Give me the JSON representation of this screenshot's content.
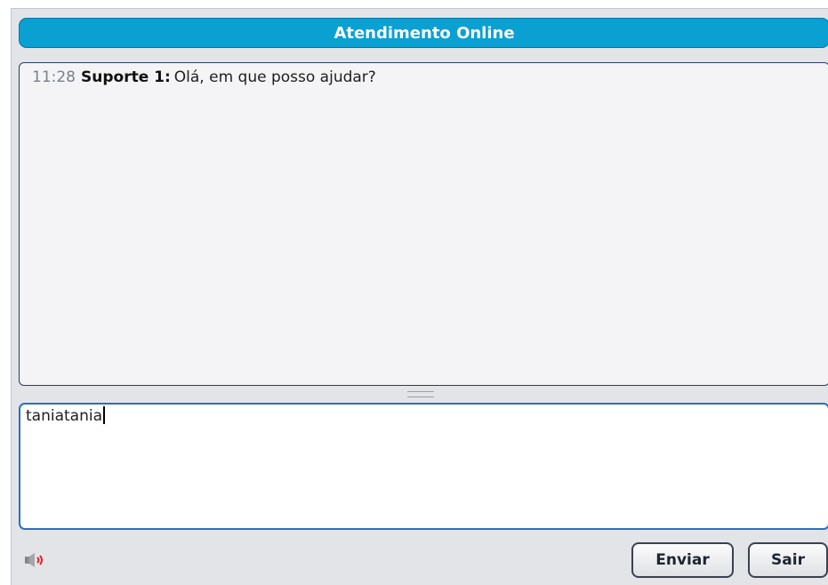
{
  "window": {
    "title": "Atendimento Online"
  },
  "messages": [
    {
      "time": "11:28",
      "author": "Suporte 1:",
      "text": "Olá, em que posso ajudar?"
    }
  ],
  "compose": {
    "value": "taniatania"
  },
  "footer": {
    "sound_icon": "speaker-icon",
    "send_label": "Enviar",
    "exit_label": "Sair"
  },
  "colors": {
    "title_bar": "#0aa0d2",
    "window_bg": "#e3e4e8",
    "input_border": "#2b6fc0"
  }
}
